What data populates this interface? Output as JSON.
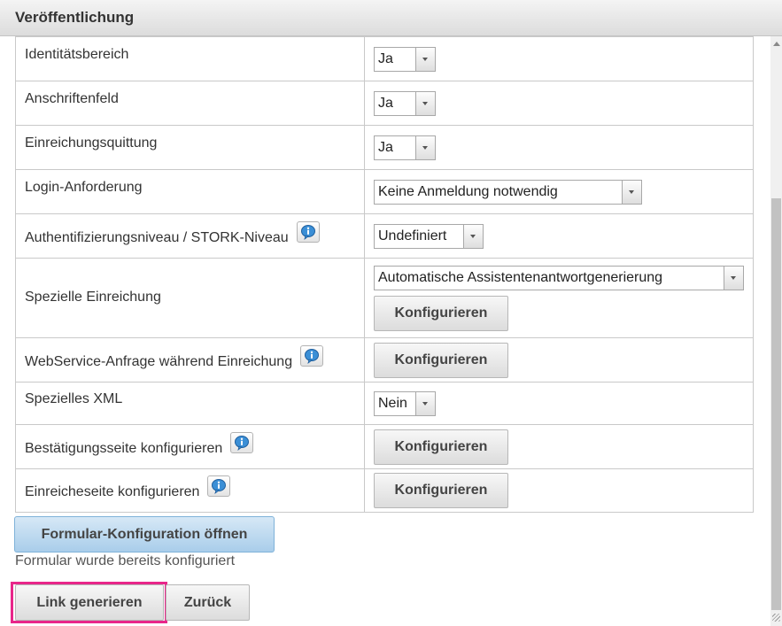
{
  "dialog": {
    "title": "Veröffentlichung"
  },
  "rows": [
    {
      "label": "Identitätsbereich",
      "select": "Ja"
    },
    {
      "label": "Anschriftenfeld",
      "select": "Ja"
    },
    {
      "label": "Einreichungsquittung",
      "select": "Ja"
    },
    {
      "label": "Login-Anforderung",
      "select": "Keine Anmeldung notwendig"
    },
    {
      "label": "Authentifizierungsniveau / STORK-Niveau",
      "select": "Undefiniert",
      "info": "info-icon"
    },
    {
      "label": "Spezielle Einreichung",
      "select": "Automatische Assistentenantwortgenerierung",
      "button": "Konfigurieren"
    },
    {
      "label": "WebService-Anfrage während Einreichung",
      "button": "Konfigurieren",
      "info": "info-icon"
    },
    {
      "label": "Spezielles XML",
      "select": "Nein"
    },
    {
      "label": "Bestätigungsseite konfigurieren",
      "button": "Konfigurieren",
      "info": "info-icon"
    },
    {
      "label": "Einreicheseite konfigurieren",
      "button": "Konfigurieren",
      "info": "info-icon"
    }
  ],
  "actions": {
    "open_form_config": "Formular-Konfiguration öffnen",
    "status_note": "Formular wurde bereits konfiguriert",
    "generate_link": "Link generieren",
    "back": "Zurück"
  },
  "colors": {
    "highlight": "#e8268a",
    "primary_button": "#a9cdea",
    "info_icon": "#3b8fd6"
  }
}
